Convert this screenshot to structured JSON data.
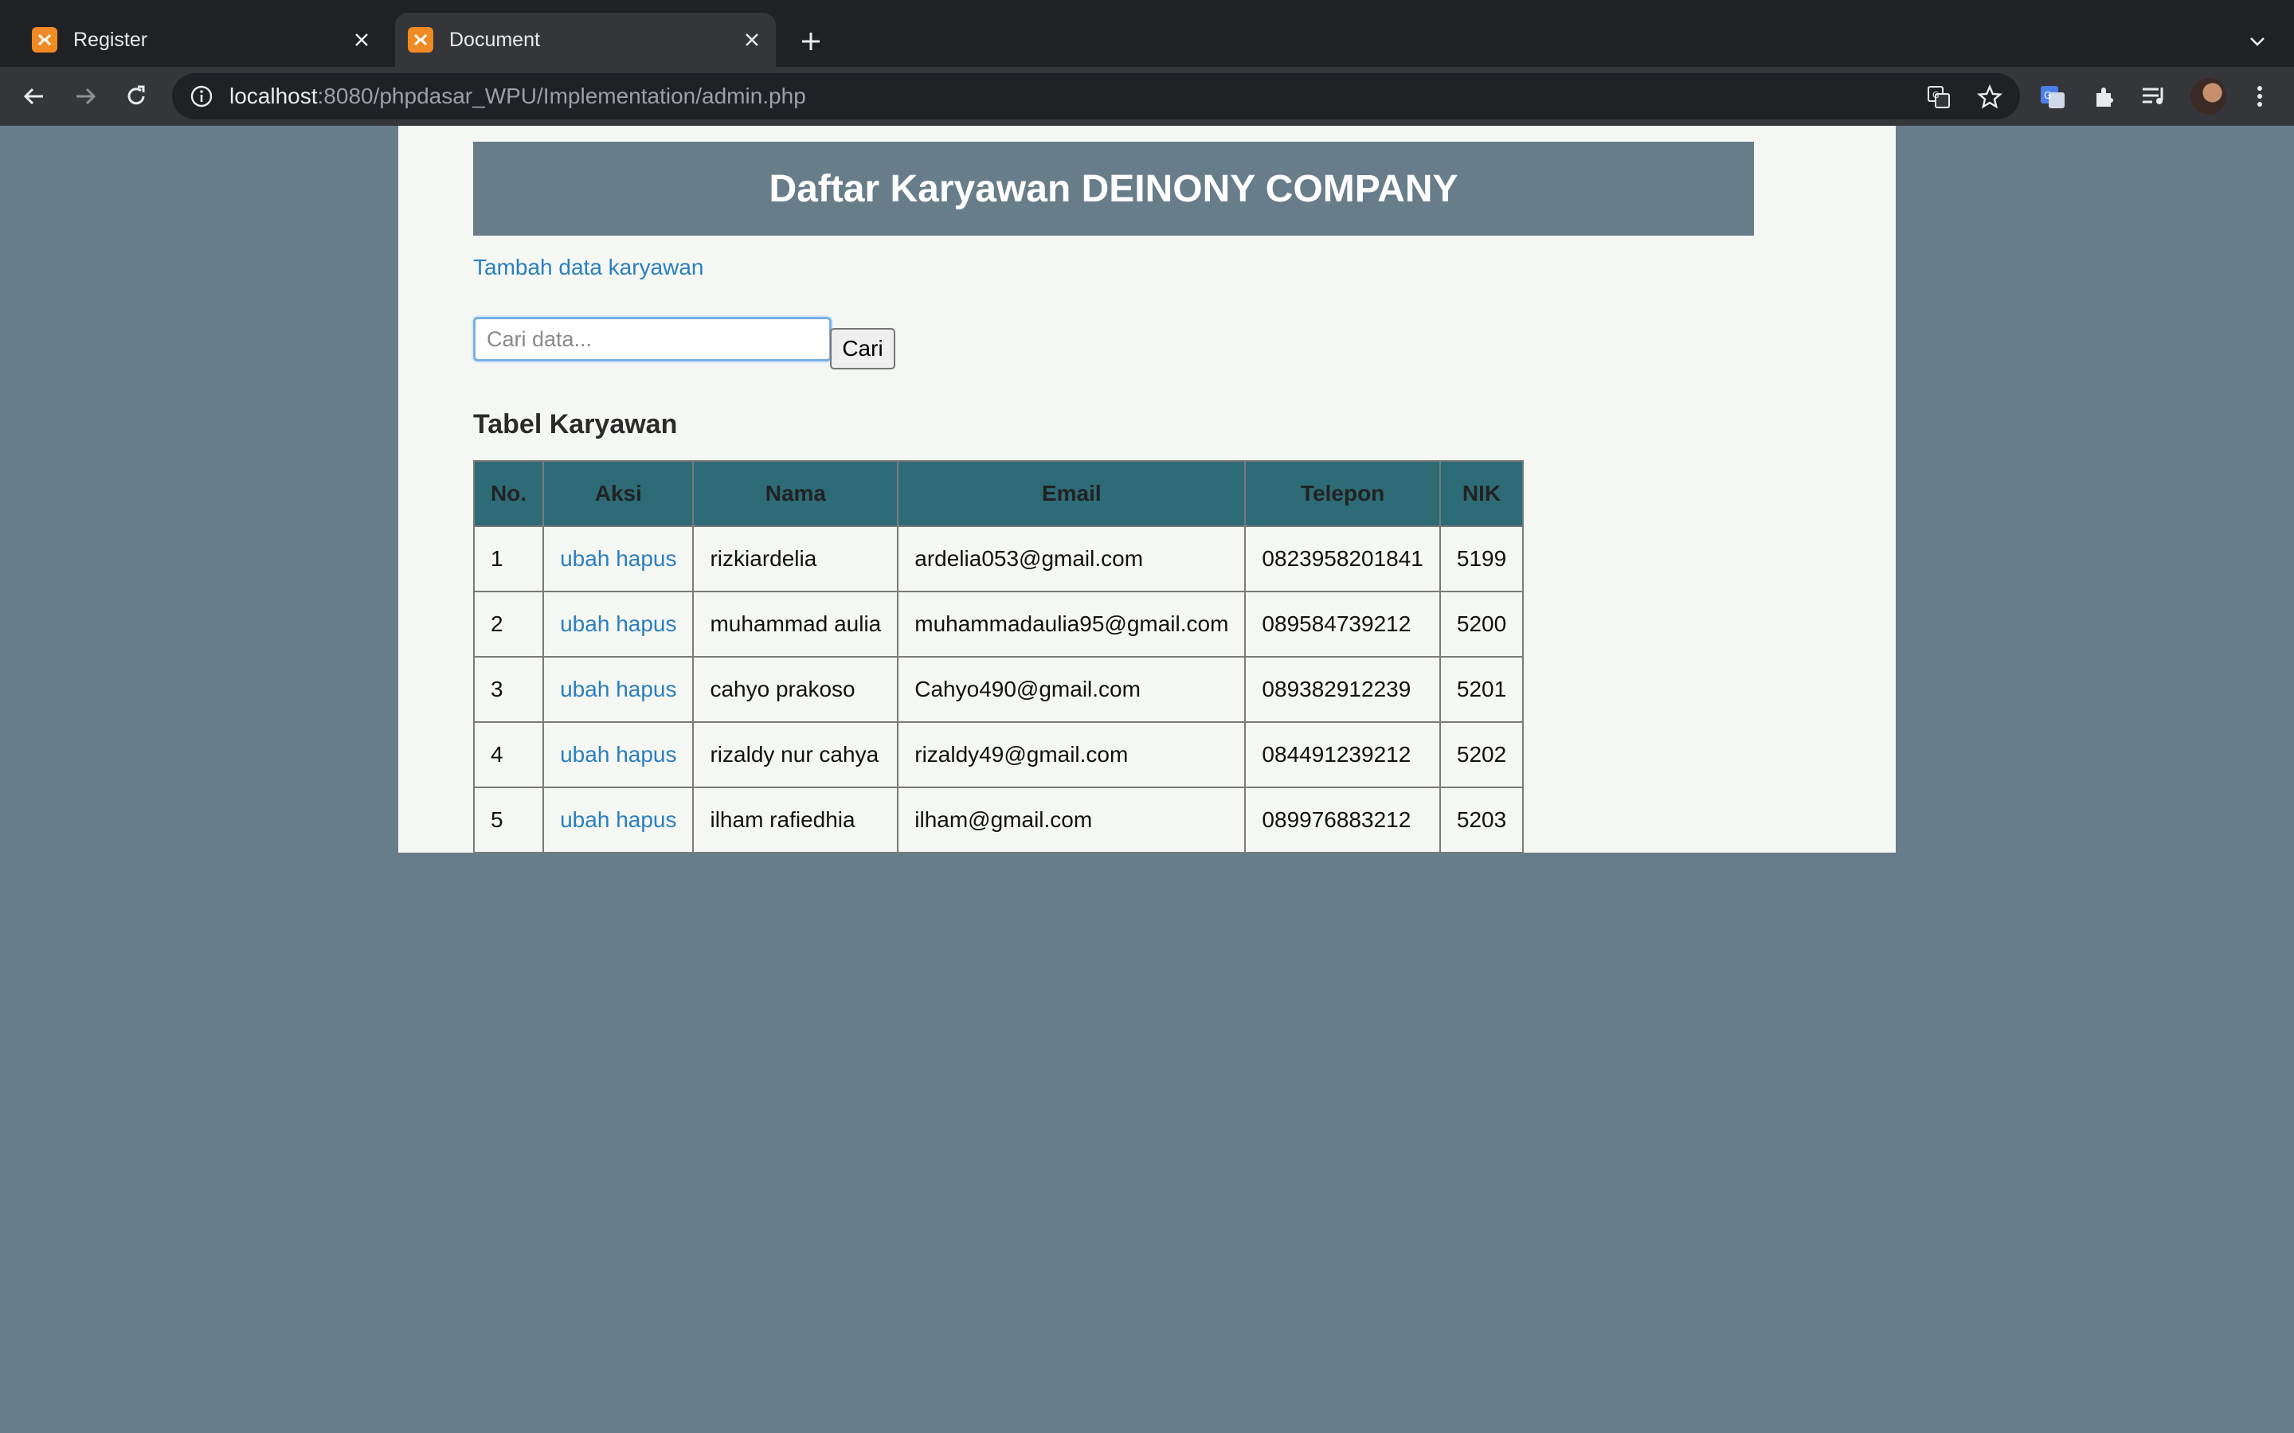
{
  "browser": {
    "tabs": [
      {
        "title": "Register",
        "active": false
      },
      {
        "title": "Document",
        "active": true
      }
    ],
    "url_host": "localhost",
    "url_rest": ":8080/phpdasar_WPU/Implementation/admin.php"
  },
  "page": {
    "banner_title": "Daftar Karyawan DEINONY COMPANY",
    "add_link": "Tambah data karyawan",
    "search": {
      "placeholder": "Cari data...",
      "value": "",
      "button": "Cari"
    },
    "table_title": "Tabel Karyawan",
    "columns": [
      "No.",
      "Aksi",
      "Nama",
      "Email",
      "Telepon",
      "NIK"
    ],
    "rows": [
      {
        "no": "1",
        "edit": "ubah",
        "delete": "hapus",
        "nama": "rizkiardelia",
        "email": "ardelia053@gmail.com",
        "telepon": "0823958201841",
        "nik": "5199"
      },
      {
        "no": "2",
        "edit": "ubah",
        "delete": "hapus",
        "nama": "muhammad aulia",
        "email": "muhammadaulia95@gmail.com",
        "telepon": "089584739212",
        "nik": "5200"
      },
      {
        "no": "3",
        "edit": "ubah",
        "delete": "hapus",
        "nama": "cahyo prakoso",
        "email": "Cahyo490@gmail.com",
        "telepon": "089382912239",
        "nik": "5201"
      },
      {
        "no": "4",
        "edit": "ubah",
        "delete": "hapus",
        "nama": "rizaldy nur cahya",
        "email": "rizaldy49@gmail.com",
        "telepon": "084491239212",
        "nik": "5202"
      },
      {
        "no": "5",
        "edit": "ubah",
        "delete": "hapus",
        "nama": "ilham rafiedhia",
        "email": "ilham@gmail.com",
        "telepon": "089976883212",
        "nik": "5203"
      }
    ]
  },
  "colors": {
    "background": "#687d8a",
    "page": "#f5f7f2",
    "banner": "#687d8a",
    "table_header": "#2d6b76",
    "link": "#2a7fc1"
  },
  "icons": [
    "xampp-favicon-icon",
    "close-icon",
    "plus-icon",
    "chevron-down-icon",
    "back-arrow-icon",
    "forward-arrow-icon",
    "reload-icon",
    "info-icon",
    "translate-icon",
    "star-icon",
    "google-translate-icon",
    "extensions-puzzle-icon",
    "media-queue-icon",
    "more-vert-icon"
  ]
}
